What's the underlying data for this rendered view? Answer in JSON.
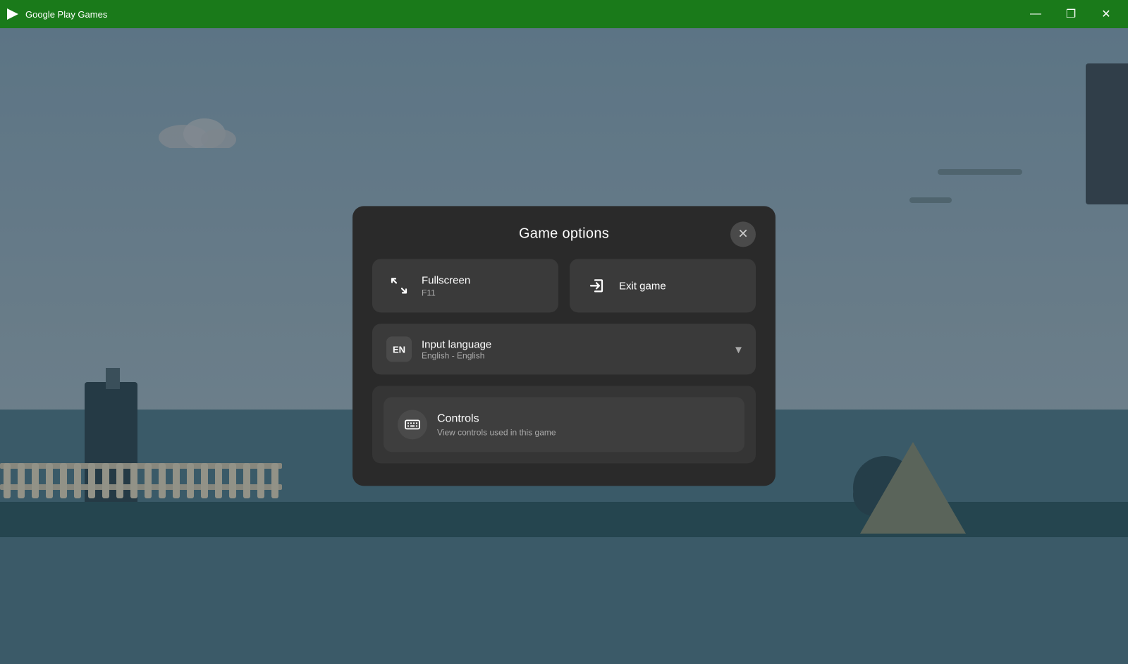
{
  "titlebar": {
    "app_name": "Google Play Games",
    "minimize_label": "—",
    "maximize_label": "❐",
    "close_label": "✕"
  },
  "modal": {
    "title": "Game options",
    "close_label": "✕",
    "fullscreen": {
      "label": "Fullscreen",
      "shortcut": "F11"
    },
    "exit_game": {
      "label": "Exit game"
    },
    "input_language": {
      "badge": "EN",
      "label": "Input language",
      "value": "English - English"
    },
    "controls": {
      "label": "Controls",
      "description": "View controls used in this game"
    }
  }
}
